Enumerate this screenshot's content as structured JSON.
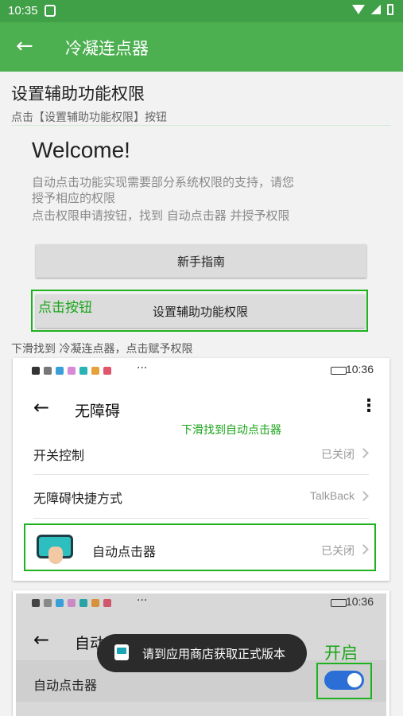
{
  "status_bar": {
    "time": "10:35"
  },
  "app_bar": {
    "title": "冷凝连点器"
  },
  "section": {
    "title": "设置辅助功能权限",
    "subtitle": "点击【设置辅助功能权限】按钮"
  },
  "welcome": {
    "heading": "Welcome!",
    "desc_lines": [
      "自动点击功能实现需要部分系统权限的支持，请您",
      "授予相应的权限",
      "点击权限申请按钮，找到 自动点击器 并授予权限"
    ]
  },
  "buttons": {
    "guide": "新手指南",
    "accessibility": "设置辅助功能权限"
  },
  "annotations": {
    "click_button": "点击按钮",
    "scroll_find": "下滑找到自动点击器",
    "enable": "开启"
  },
  "hint": "下滑找到 冷凝连点器，点击赋予权限",
  "screenshot1": {
    "time": "10:36",
    "ellipsis": "···",
    "title": "无障碍",
    "rows": [
      {
        "label": "开关控制",
        "value": "已关闭"
      },
      {
        "label": "无障碍快捷方式",
        "value": "TalkBack"
      },
      {
        "label": "自动点击器",
        "value": "已关闭"
      }
    ]
  },
  "screenshot2": {
    "time": "10:36",
    "ellipsis": "···",
    "title": "自动点击器",
    "row_label": "自动点击器",
    "toggle_on": true
  },
  "toast": "请到应用商店获取正式版本",
  "colors": {
    "app_bar": "#4caf50",
    "status_bar": "#3fa047",
    "highlight": "#1fb21f",
    "toggle": "#2b6fd6"
  }
}
